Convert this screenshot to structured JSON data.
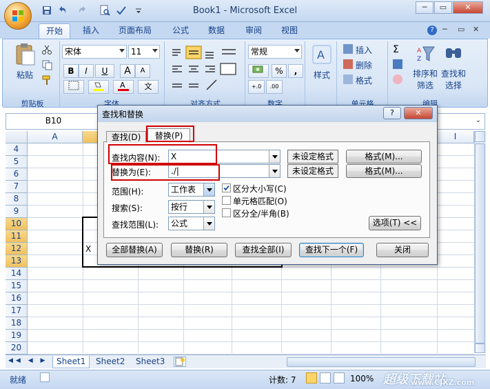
{
  "window": {
    "title": "Book1 - Microsoft Excel",
    "minimize": "─",
    "restore": "▭",
    "close": "✕"
  },
  "ribbon_tabs": [
    "开始",
    "插入",
    "页面布局",
    "公式",
    "数据",
    "审阅",
    "视图"
  ],
  "ribbon_right": {
    "help": "?",
    "min": "─",
    "restore": "▭",
    "close": "✕"
  },
  "ribbon": {
    "clipboard": {
      "paste": "粘贴",
      "label": "剪贴板"
    },
    "font": {
      "name": "宋体",
      "size": "11",
      "bold": "B",
      "italic": "I",
      "underline": "U",
      "grow": "A",
      "shrink": "A",
      "wen": "文",
      "label": "字体"
    },
    "align": {
      "label": "对齐方式"
    },
    "number": {
      "format": "常规",
      "percent": "%",
      "comma": ",",
      "label": "数字"
    },
    "styles": {
      "label": "样式"
    },
    "cells": {
      "insert": "插入",
      "delete": "删除",
      "format": "格式",
      "label": "单元格"
    },
    "editing": {
      "sum": "Σ",
      "sort": "排序和\n筛选",
      "find": "查找和\n选择",
      "label": "编辑"
    }
  },
  "formula_bar": {
    "name_box": "B10"
  },
  "columns": [
    "A",
    "I"
  ],
  "rows": [
    "4",
    "5",
    "6",
    "7",
    "8",
    "9",
    "10",
    "11",
    "12",
    "13",
    "14",
    "15",
    "16",
    "17",
    "18",
    "19",
    "20"
  ],
  "selected_rows": [
    "10",
    "11",
    "12",
    "13"
  ],
  "cell_x": "X",
  "sheets": [
    "Sheet1",
    "Sheet2",
    "Sheet3"
  ],
  "status": {
    "ready": "就绪",
    "count": "计数: 7",
    "zoom": "100%",
    "minus": "−",
    "plus": "+"
  },
  "watermark": {
    "line1": "超级下载站",
    "line2": "www.CJXZ.com"
  },
  "dialog": {
    "title": "查找和替换",
    "help": "?",
    "close": "✕",
    "tab_find": "查找(D)",
    "tab_replace": "替换(P)",
    "find_label": "查找内容(N):",
    "find_value": "X",
    "replace_label": "替换为(E):",
    "replace_value": "./|",
    "no_format": "未设定格式",
    "format_btn": "格式(M)...",
    "scope_label": "范围(H):",
    "scope_value": "工作表",
    "search_label": "搜索(S):",
    "search_value": "按行",
    "lookin_label": "查找范围(L):",
    "lookin_value": "公式",
    "match_case": "区分大小写(C)",
    "match_cell": "单元格匹配(O)",
    "match_width": "区分全/半角(B)",
    "options": "选项(T) <<",
    "replace_all": "全部替换(A)",
    "replace": "替换(R)",
    "find_all": "查找全部(I)",
    "find_next": "查找下一个(F)",
    "close_btn": "关闭"
  }
}
